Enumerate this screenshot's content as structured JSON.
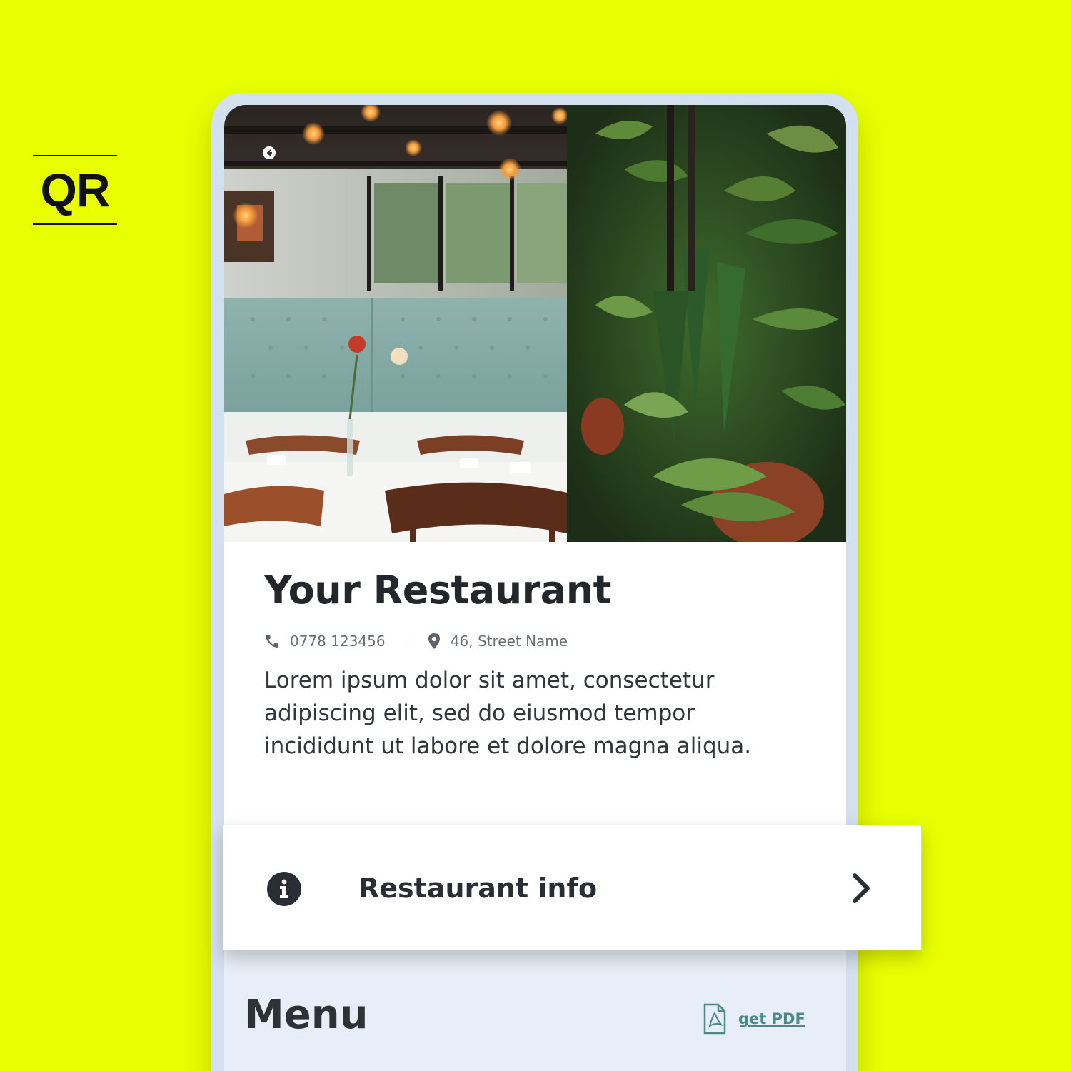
{
  "badge": {
    "text": "QR"
  },
  "restaurant": {
    "name": "Your Restaurant",
    "phone": "0778 123456",
    "separator": "·",
    "address": "46, Street Name",
    "description": "Lorem ipsum dolor sit amet, consectetur adipiscing elit, sed do eiusmod tempor incididunt ut labore et dolore magna aliqua."
  },
  "info_card": {
    "label": "Restaurant info"
  },
  "menu": {
    "title": "Menu",
    "pdf_link": "get PDF"
  },
  "colors": {
    "background": "#e8ff00",
    "accent_link": "#4a8a88",
    "text_dark": "#23262b",
    "menu_bg": "#e7eef7"
  },
  "icons": [
    "back-arrow-icon",
    "phone-icon",
    "location-pin-icon",
    "info-icon",
    "chevron-right-icon",
    "pdf-file-icon"
  ]
}
